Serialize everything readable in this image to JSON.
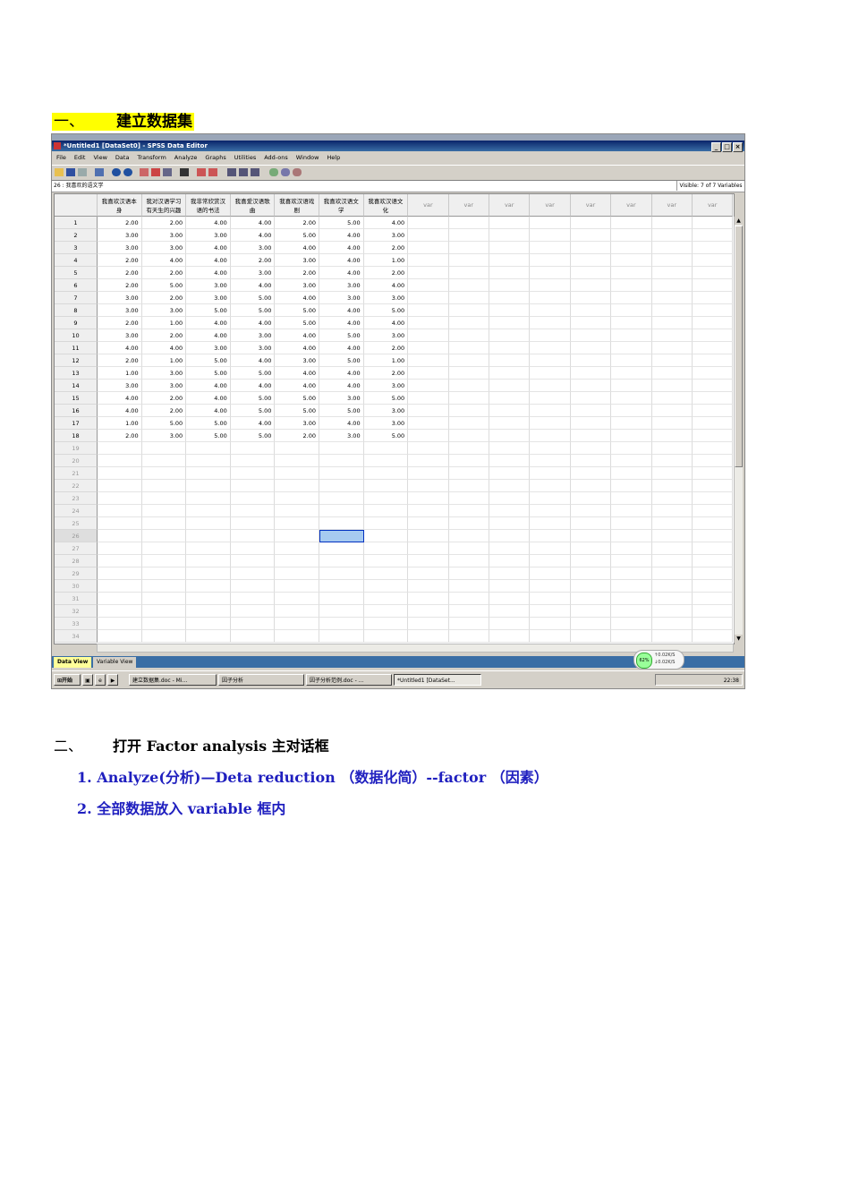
{
  "section1": {
    "num": "一、",
    "title": "建立数据集"
  },
  "spss": {
    "title": "*Untitled1 [DataSet0] - SPSS Data Editor",
    "menu": [
      "File",
      "Edit",
      "View",
      "Data",
      "Transform",
      "Analyze",
      "Graphs",
      "Utilities",
      "Add-ons",
      "Window",
      "Help"
    ],
    "cell_ref": "26 : 我喜欢的语文学",
    "visible": "Visible: 7 of 7 Variables",
    "columns": [
      [
        "我喜欢汉语本",
        "身"
      ],
      [
        "我对汉语学习",
        "有天生的兴趣"
      ],
      [
        "我非常欣赏汉",
        "语的书法"
      ],
      [
        "我喜爱汉语歌",
        "曲"
      ],
      [
        "我喜欢汉语戏",
        "剧"
      ],
      [
        "我喜欢汉语文",
        "学"
      ],
      [
        "我喜欢汉语文",
        "化"
      ]
    ],
    "var_label": "var",
    "rows": [
      [
        "2.00",
        "2.00",
        "4.00",
        "4.00",
        "2.00",
        "5.00",
        "4.00"
      ],
      [
        "3.00",
        "3.00",
        "3.00",
        "4.00",
        "5.00",
        "4.00",
        "3.00"
      ],
      [
        "3.00",
        "3.00",
        "4.00",
        "3.00",
        "4.00",
        "4.00",
        "2.00"
      ],
      [
        "2.00",
        "4.00",
        "4.00",
        "2.00",
        "3.00",
        "4.00",
        "1.00"
      ],
      [
        "2.00",
        "2.00",
        "4.00",
        "3.00",
        "2.00",
        "4.00",
        "2.00"
      ],
      [
        "2.00",
        "5.00",
        "3.00",
        "4.00",
        "3.00",
        "3.00",
        "4.00"
      ],
      [
        "3.00",
        "2.00",
        "3.00",
        "5.00",
        "4.00",
        "3.00",
        "3.00"
      ],
      [
        "3.00",
        "3.00",
        "5.00",
        "5.00",
        "5.00",
        "4.00",
        "5.00"
      ],
      [
        "2.00",
        "1.00",
        "4.00",
        "4.00",
        "5.00",
        "4.00",
        "4.00"
      ],
      [
        "3.00",
        "2.00",
        "4.00",
        "3.00",
        "4.00",
        "5.00",
        "3.00"
      ],
      [
        "4.00",
        "4.00",
        "3.00",
        "3.00",
        "4.00",
        "4.00",
        "2.00"
      ],
      [
        "2.00",
        "1.00",
        "5.00",
        "4.00",
        "3.00",
        "5.00",
        "1.00"
      ],
      [
        "1.00",
        "3.00",
        "5.00",
        "5.00",
        "4.00",
        "4.00",
        "2.00"
      ],
      [
        "3.00",
        "3.00",
        "4.00",
        "4.00",
        "4.00",
        "4.00",
        "3.00"
      ],
      [
        "4.00",
        "2.00",
        "4.00",
        "5.00",
        "5.00",
        "3.00",
        "5.00"
      ],
      [
        "4.00",
        "2.00",
        "4.00",
        "5.00",
        "5.00",
        "5.00",
        "3.00"
      ],
      [
        "1.00",
        "5.00",
        "5.00",
        "4.00",
        "3.00",
        "4.00",
        "3.00"
      ],
      [
        "2.00",
        "3.00",
        "5.00",
        "5.00",
        "2.00",
        "3.00",
        "5.00"
      ]
    ],
    "empty_rows": [
      "19",
      "20",
      "21",
      "22",
      "23",
      "24",
      "25",
      "26",
      "27",
      "28",
      "29",
      "30",
      "31",
      "32",
      "33",
      "34"
    ],
    "tabs": {
      "data_view": "Data View",
      "variable_view": "Variable View"
    },
    "net": {
      "percent": "62%",
      "up": "0.02K/S",
      "down": "0.02K/S"
    },
    "taskbar": {
      "start": "开始",
      "items": [
        "建立数据集.doc - Mi...",
        "因子分析",
        "因子分析范例.doc - ...",
        "*Untitled1 [DataSet..."
      ],
      "clock": "22:38"
    },
    "colors": {
      "title": "#0a246a",
      "active_tab": "#ffff99",
      "selection": "#a6caf0"
    }
  },
  "section2": {
    "num": "二、",
    "title": "打开 Factor analysis 主对话框"
  },
  "steps": [
    "1. Analyze(分析)—Deta reduction （数据化简）--factor （因素）",
    "2. 全部数据放入 variable 框内"
  ]
}
